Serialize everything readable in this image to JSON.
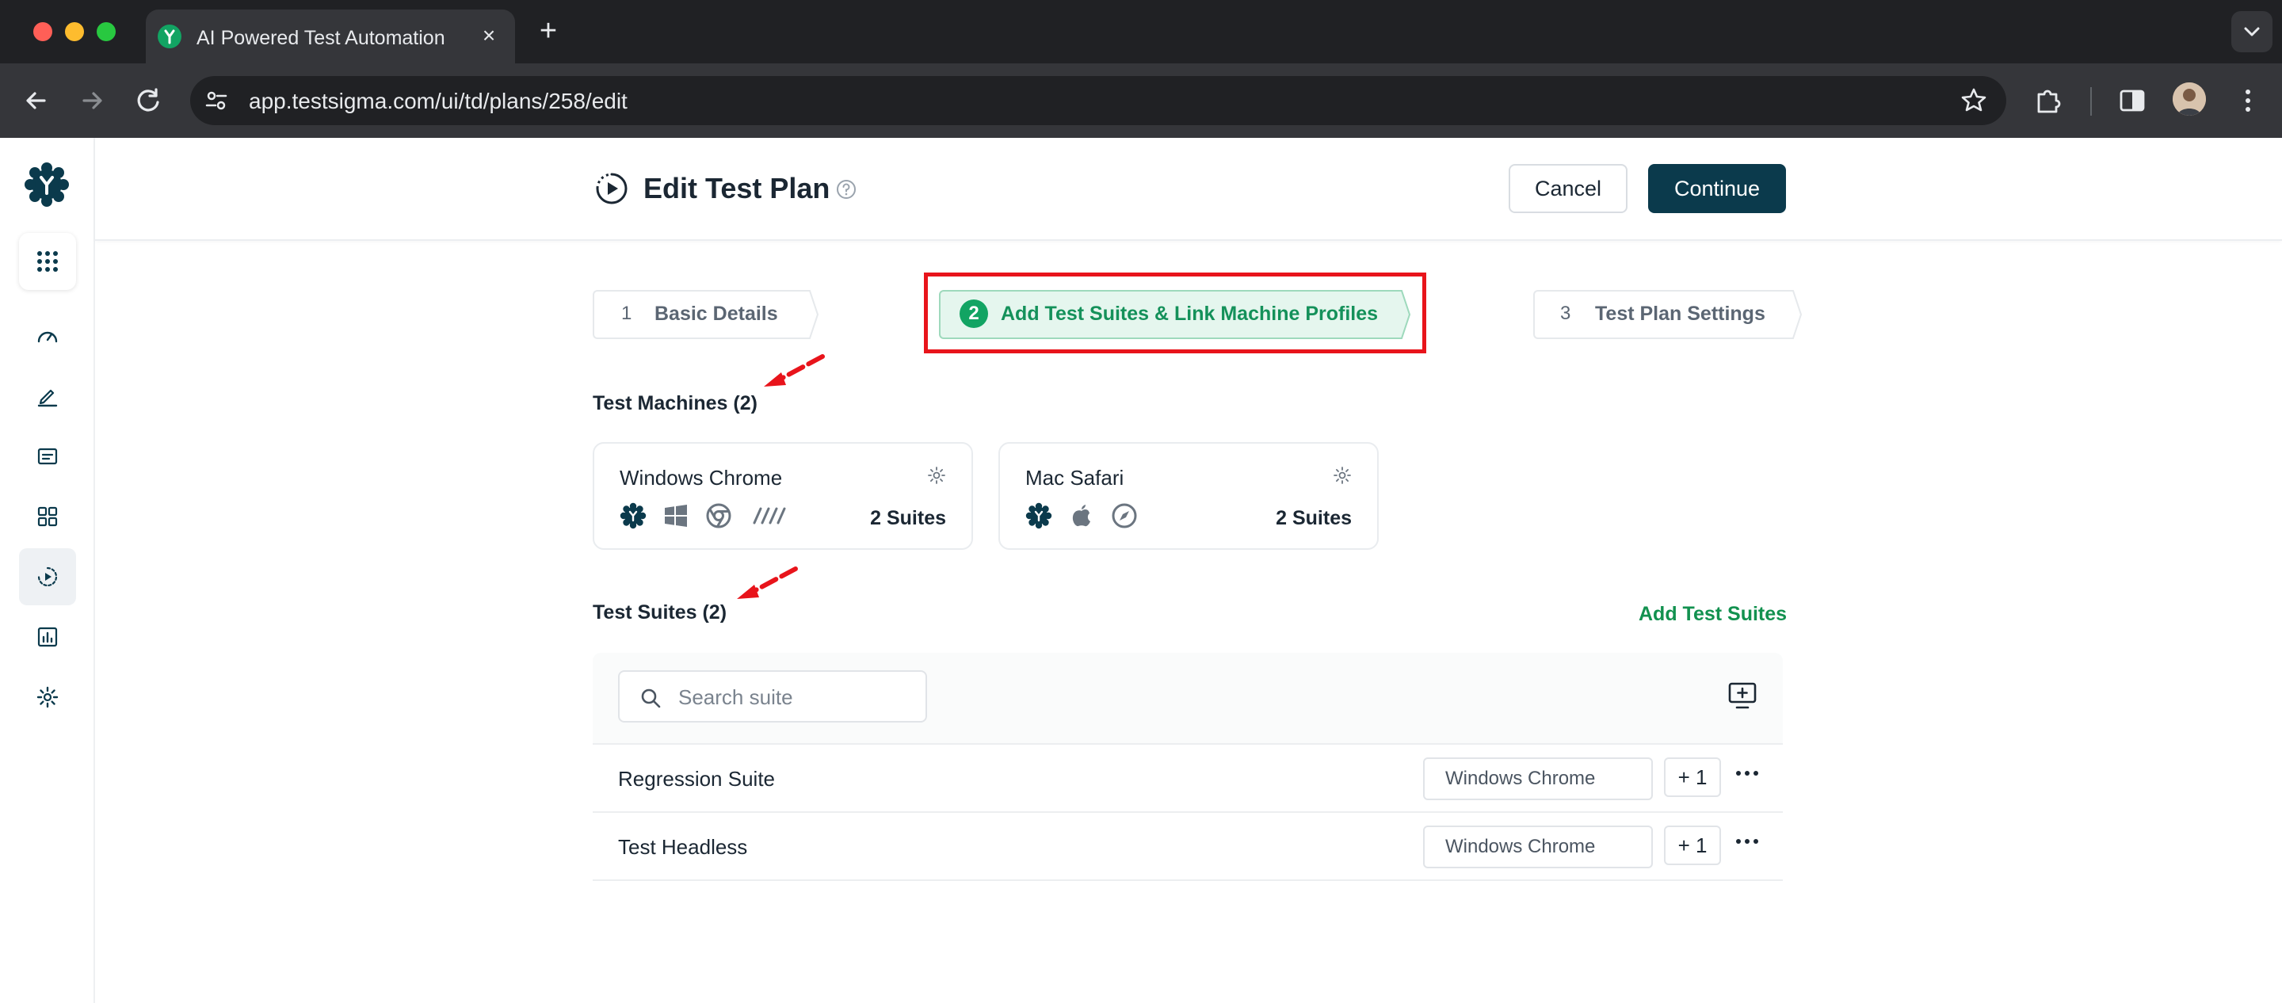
{
  "browser": {
    "tab_title": "AI Powered Test Automation",
    "url": "app.testsigma.com/ui/td/plans/258/edit"
  },
  "sidebar": {
    "items": [
      {
        "icon": "dashboard-icon"
      },
      {
        "icon": "edit-icon"
      },
      {
        "icon": "folder-icon"
      },
      {
        "icon": "grid-icon"
      },
      {
        "icon": "test-plan-icon",
        "active": true
      },
      {
        "icon": "reports-icon"
      },
      {
        "icon": "settings-icon"
      }
    ]
  },
  "header": {
    "title": "Edit Test Plan",
    "cancel_label": "Cancel",
    "continue_label": "Continue"
  },
  "steps": [
    {
      "number": "1",
      "label": "Basic Details"
    },
    {
      "number": "2",
      "label": "Add Test Suites & Link Machine Profiles",
      "active": true
    },
    {
      "number": "3",
      "label": "Test Plan Settings"
    }
  ],
  "machines": {
    "title": "Test Machines (2)",
    "cards": [
      {
        "name": "Windows Chrome",
        "suites": "2 Suites",
        "icons": [
          "testsigma-icon",
          "windows-icon",
          "chrome-icon",
          "headless-icon"
        ]
      },
      {
        "name": "Mac Safari",
        "suites": "2 Suites",
        "icons": [
          "testsigma-icon",
          "apple-icon",
          "safari-icon"
        ]
      }
    ]
  },
  "suites": {
    "title": "Test Suites (2)",
    "add_label": "Add Test Suites",
    "search_placeholder": "Search suite",
    "rows": [
      {
        "name": "Regression Suite",
        "machine": "Windows Chrome",
        "extra": "+ 1"
      },
      {
        "name": "Test Headless",
        "machine": "Windows Chrome",
        "extra": "+ 1"
      }
    ]
  },
  "colors": {
    "brand": "#0b3a4c",
    "accent_green": "#12a463",
    "annotation_red": "#e8141b"
  }
}
